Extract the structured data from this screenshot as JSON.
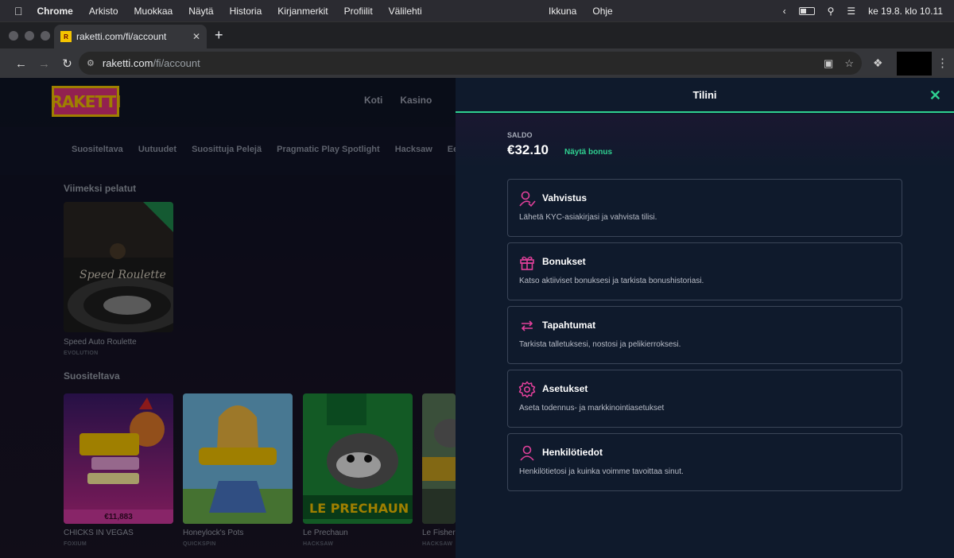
{
  "macos": {
    "menu": [
      "Chrome",
      "Arkisto",
      "Muokkaa",
      "Näytä",
      "Historia",
      "Kirjanmerkit",
      "Profiilit",
      "Välilehti"
    ],
    "center_menu": [
      "Ikkuna",
      "Ohje"
    ],
    "clock": "ke 19.8. klo 10.11"
  },
  "browser": {
    "tab_title": "raketti.com/fi/account",
    "url_host": "raketti.com",
    "url_path": "/fi/account",
    "new_tab": "+"
  },
  "site": {
    "logo": "RAKETTI",
    "nav": [
      "Koti",
      "Kasino"
    ],
    "categories": [
      "Suositeltava",
      "Uutuudet",
      "Suosittuja Pelejä",
      "Pragmatic Play Spotlight",
      "Hacksaw",
      "Eep"
    ],
    "recent_title": "Viimeksi pelatut",
    "recent_game": {
      "name": "Speed Auto Roulette",
      "provider": "EVOLUTION"
    },
    "recommended_title": "Suositeltava",
    "games": [
      {
        "name": "CHICKS IN VEGAS",
        "provider": "FOXIUM",
        "jackpot": "€11,883"
      },
      {
        "name": "Honeylock's Pots",
        "provider": "QUICKSPIN"
      },
      {
        "name": "Le Prechaun",
        "provider": "HACKSAW"
      },
      {
        "name": "Le Fisher",
        "provider": "HACKSAW"
      }
    ]
  },
  "account_panel": {
    "title": "Tilini",
    "saldo_label": "SALDO",
    "saldo_value": "€32.10",
    "bonus_link": "Näytä bonus",
    "items": [
      {
        "title": "Vahvistus",
        "desc": "Lähetä KYC-asiakirjasi ja vahvista tilisi.",
        "icon": "user-check-icon"
      },
      {
        "title": "Bonukset",
        "desc": "Katso aktiiviset bonuksesi ja tarkista bonushistoriasi.",
        "icon": "gift-icon"
      },
      {
        "title": "Tapahtumat",
        "desc": "Tarkista talletuksesi, nostosi ja pelikierroksesi.",
        "icon": "transfer-arrows-icon"
      },
      {
        "title": "Asetukset",
        "desc": "Aseta todennus- ja markkinointiasetukset",
        "icon": "gear-icon"
      },
      {
        "title": "Henkilötiedot",
        "desc": "Henkilötietosi ja kuinka voimme tavoittaa sinut.",
        "icon": "user-icon"
      }
    ],
    "colors": {
      "accent": "#2fd090",
      "icon": "#e0409a"
    }
  }
}
